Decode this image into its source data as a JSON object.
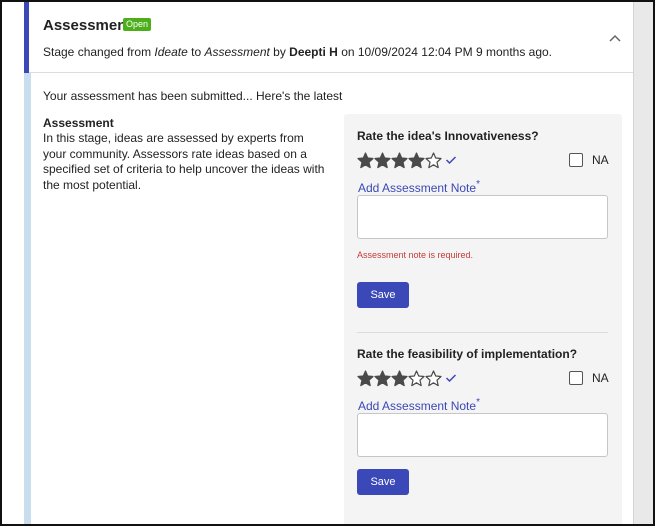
{
  "header": {
    "title": "Assessment",
    "badge": "Open",
    "sub_prefix": "Stage changed from ",
    "from_stage": "Ideate",
    "sub_to": " to ",
    "to_stage": "Assessment",
    "sub_by": " by ",
    "user": "Deepti H",
    "sub_suffix": " on 10/09/2024 12:04 PM 9 months ago.",
    "collapse_icon": "chevron-up-icon"
  },
  "body": {
    "submitted_text": "Your assessment has been submitted... Here's the latest",
    "desc_title": "Assessment",
    "desc_text": "In this stage, ideas are assessed by experts from your community. Assessors rate ideas based on a specified set of criteria to help uncover the ideas with the most potential."
  },
  "questions": [
    {
      "title": "Rate the idea's Innovativeness?",
      "rating": 4,
      "max_rating": 5,
      "na_label": "NA",
      "na_checked": false,
      "note_label": "Add Assessment Note",
      "required_marker": "*",
      "note_value": "",
      "error": "Assessment note is required.",
      "save_label": "Save"
    },
    {
      "title": "Rate the feasibility of implementation?",
      "rating": 3,
      "max_rating": 5,
      "na_label": "NA",
      "na_checked": false,
      "note_label": "Add Assessment Note",
      "required_marker": "*",
      "note_value": "",
      "error": "",
      "save_label": "Save"
    }
  ],
  "colors": {
    "accent": "#3b48b7",
    "badge": "#4caf1a",
    "error": "#c63b3b",
    "star_filled": "#4a4a4a",
    "side_stripe": "#c8ddee"
  }
}
